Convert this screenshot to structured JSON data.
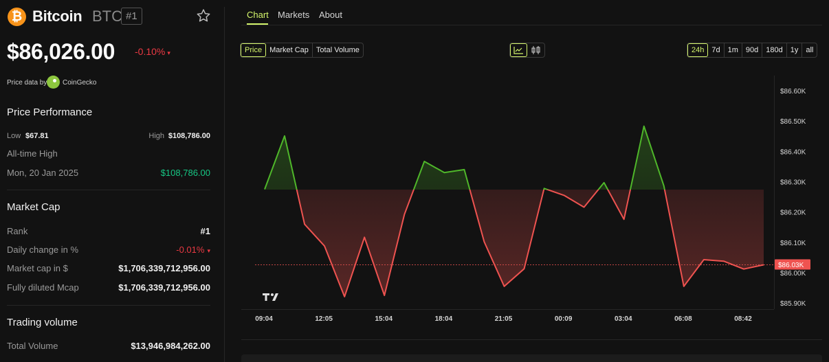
{
  "coin": {
    "name": "Bitcoin",
    "symbol": "BTC",
    "rank_badge": "#1",
    "price": "$86,026.00",
    "change": "-0.10%",
    "change_caret": "▾",
    "source_label": "Price data by",
    "source_name": "CoinGecko"
  },
  "performance": {
    "title": "Price Performance",
    "low_label": "Low",
    "low_value": "$67.81",
    "high_label": "High",
    "high_value": "$108,786.00",
    "ath_label": "All-time High",
    "ath_date": "Mon, 20 Jan 2025",
    "ath_value": "$108,786.00"
  },
  "market_cap": {
    "title": "Market Cap",
    "rows": [
      {
        "label": "Rank",
        "value": "#1"
      },
      {
        "label": "Daily change in %",
        "value": "-0.01%",
        "caret": "▾"
      },
      {
        "label": "Market cap in $",
        "value": "$1,706,339,712,956.00"
      },
      {
        "label": "Fully diluted Mcap",
        "value": "$1,706,339,712,956.00"
      }
    ]
  },
  "trading": {
    "title": "Trading volume",
    "total_label": "Total Volume",
    "total_value": "$13,946,984,262.00"
  },
  "tabs": [
    {
      "label": "Chart",
      "active": true
    },
    {
      "label": "Markets",
      "active": false
    },
    {
      "label": "About",
      "active": false
    }
  ],
  "metric_buttons": [
    {
      "label": "Price",
      "active": true
    },
    {
      "label": "Market Cap",
      "active": false
    },
    {
      "label": "Total Volume",
      "active": false
    }
  ],
  "chart_type_buttons": [
    {
      "icon": "line-chart-icon",
      "active": true
    },
    {
      "icon": "candlestick-icon",
      "active": false
    }
  ],
  "range_buttons": [
    {
      "label": "24h",
      "active": true
    },
    {
      "label": "7d",
      "active": false
    },
    {
      "label": "1m",
      "active": false
    },
    {
      "label": "90d",
      "active": false
    },
    {
      "label": "180d",
      "active": false
    },
    {
      "label": "1y",
      "active": false
    },
    {
      "label": "all",
      "active": false
    }
  ],
  "colors": {
    "up": "#4fb72a",
    "down": "#ef5350",
    "accent": "#d4f56c",
    "current_price_tag": "#ef5350"
  },
  "chart_data": {
    "type": "line",
    "title": "",
    "xlabel": "",
    "ylabel": "",
    "x_ticks": [
      "09:04",
      "12:05",
      "15:04",
      "18:04",
      "21:05",
      "00:09",
      "03:04",
      "06:08",
      "08:42"
    ],
    "y_ticks": [
      "$86.60K",
      "$86.50K",
      "$86.40K",
      "$86.30K",
      "$86.20K",
      "$86.10K",
      "$86.00K",
      "$85.90K"
    ],
    "ylim": [
      85880,
      86650
    ],
    "baseline": 86274,
    "current_label": "$86.03K",
    "current_value": 86026,
    "series": [
      {
        "values": [
          86275,
          86451,
          86160,
          86088,
          85921,
          86117,
          85925,
          86192,
          86367,
          86330,
          86340,
          86102,
          85955,
          86013,
          86278,
          86255,
          86216,
          86297,
          86176,
          86483,
          86286,
          85955,
          86043,
          86038,
          86012,
          86026
        ]
      }
    ]
  }
}
